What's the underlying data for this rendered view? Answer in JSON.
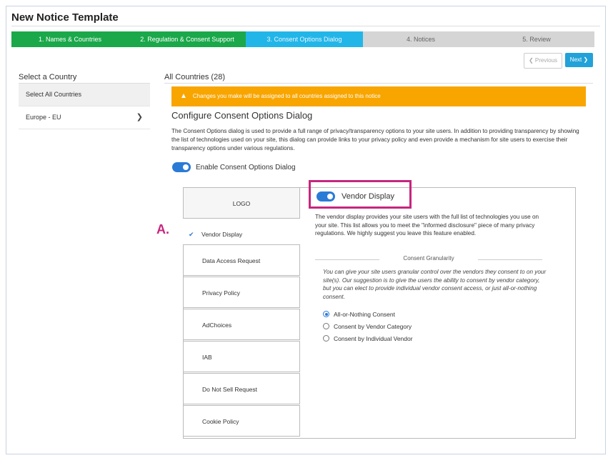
{
  "page": {
    "title": "New Notice Template"
  },
  "steps": [
    {
      "label": "1. Names & Countries",
      "state": "done"
    },
    {
      "label": "2. Regulation & Consent Support",
      "state": "done"
    },
    {
      "label": "3. Consent Options Dialog",
      "state": "active"
    },
    {
      "label": "4. Notices",
      "state": "todo"
    },
    {
      "label": "5. Review",
      "state": "todo"
    }
  ],
  "nav": {
    "previous_label": "Previous",
    "previous_icon": "chevron-left-icon",
    "next_label": "Next",
    "next_icon": "chevron-right-icon"
  },
  "sidebar": {
    "heading": "Select a Country",
    "items": [
      {
        "label": "Select All Countries"
      },
      {
        "label": "Europe - EU",
        "icon": "chevron-right-icon"
      }
    ]
  },
  "main": {
    "heading": "All Countries (28)",
    "warning": "Changes you make will be assigned to all countries assigned to this notice",
    "warning_icon": "warning-triangle-icon",
    "warning_color": "#f8a500",
    "section_title": "Configure Consent Options Dialog",
    "description": "The Consent Options dialog is used to provide a full range of privacy/transparency options to your site users. In addition to providing transparency by showing the list of technologies used on your site, this dialog can provide links to your privacy policy and even provide a mechanism for site users to exercise their transparency options under various regulations.",
    "enable_label": "Enable Consent Options Dialog",
    "enable_on": true
  },
  "tabs": [
    {
      "label": "LOGO"
    },
    {
      "label": "Vendor Display",
      "active": true
    },
    {
      "label": "Data Access Request"
    },
    {
      "label": "Privacy Policy"
    },
    {
      "label": "AdChoices"
    },
    {
      "label": "IAB"
    },
    {
      "label": "Do Not Sell Request"
    },
    {
      "label": "Cookie Policy"
    }
  ],
  "annotation": {
    "marker": "A.",
    "color": "#c6267f"
  },
  "vendor": {
    "toggle_label": "Vendor Display",
    "toggle_on": true,
    "description": "The vendor display provides your site users with the full list of technologies you use on your site. This list allows you to meet the \"informed disclosure\" piece of many privacy regulations. We highly suggest you leave this feature enabled.",
    "granularity_heading": "Consent Granularity",
    "granularity_description": "You can give your site users granular control over the vendors they consent to on your site(s). Our suggestion is to give the users the ability to consent by vendor category, but you can elect to provide individual vendor consent access, or just all-or-nothing consent.",
    "options": [
      {
        "label": "All-or-Nothing Consent",
        "selected": true
      },
      {
        "label": "Consent by Vendor Category",
        "selected": false
      },
      {
        "label": "Consent by Individual Vendor",
        "selected": false
      }
    ]
  },
  "colors": {
    "step_done": "#1aa84a",
    "step_active": "#22b6e8",
    "step_todo": "#d5d5d5",
    "accent": "#2a7bd6",
    "next_button": "#22a2d8"
  }
}
